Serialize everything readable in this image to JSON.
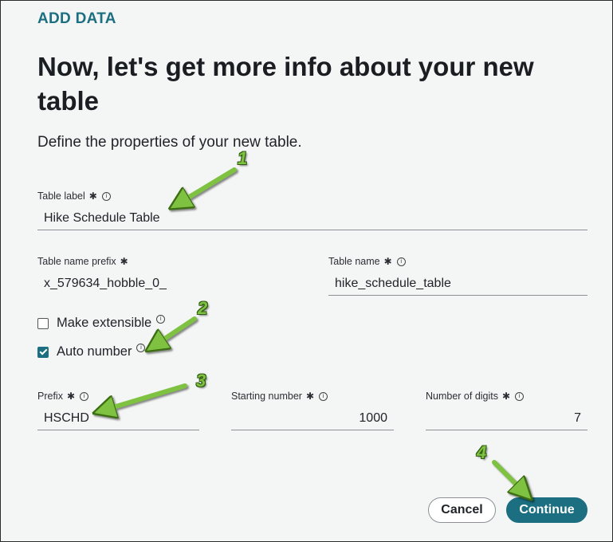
{
  "header": {
    "eyebrow": "ADD DATA",
    "title": "Now, let's get more info about your new table",
    "subtitle": "Define the properties of your new table."
  },
  "fields": {
    "table_label": {
      "label": "Table label",
      "value": "Hike Schedule Table"
    },
    "table_name_prefix": {
      "label": "Table name prefix",
      "value": "x_579634_hobble_0_"
    },
    "table_name": {
      "label": "Table name",
      "value": "hike_schedule_table"
    },
    "prefix": {
      "label": "Prefix",
      "value": "HSCHD"
    },
    "starting_number": {
      "label": "Starting number",
      "value": "1000"
    },
    "number_of_digits": {
      "label": "Number of digits",
      "value": "7"
    }
  },
  "checkboxes": {
    "make_extensible": {
      "label": "Make extensible",
      "checked": false
    },
    "auto_number": {
      "label": "Auto number",
      "checked": true
    }
  },
  "buttons": {
    "cancel": "Cancel",
    "continue": "Continue"
  },
  "callouts": [
    "1",
    "2",
    "3",
    "4"
  ],
  "colors": {
    "accent": "#1b6f80",
    "callout": "#7fc242"
  }
}
